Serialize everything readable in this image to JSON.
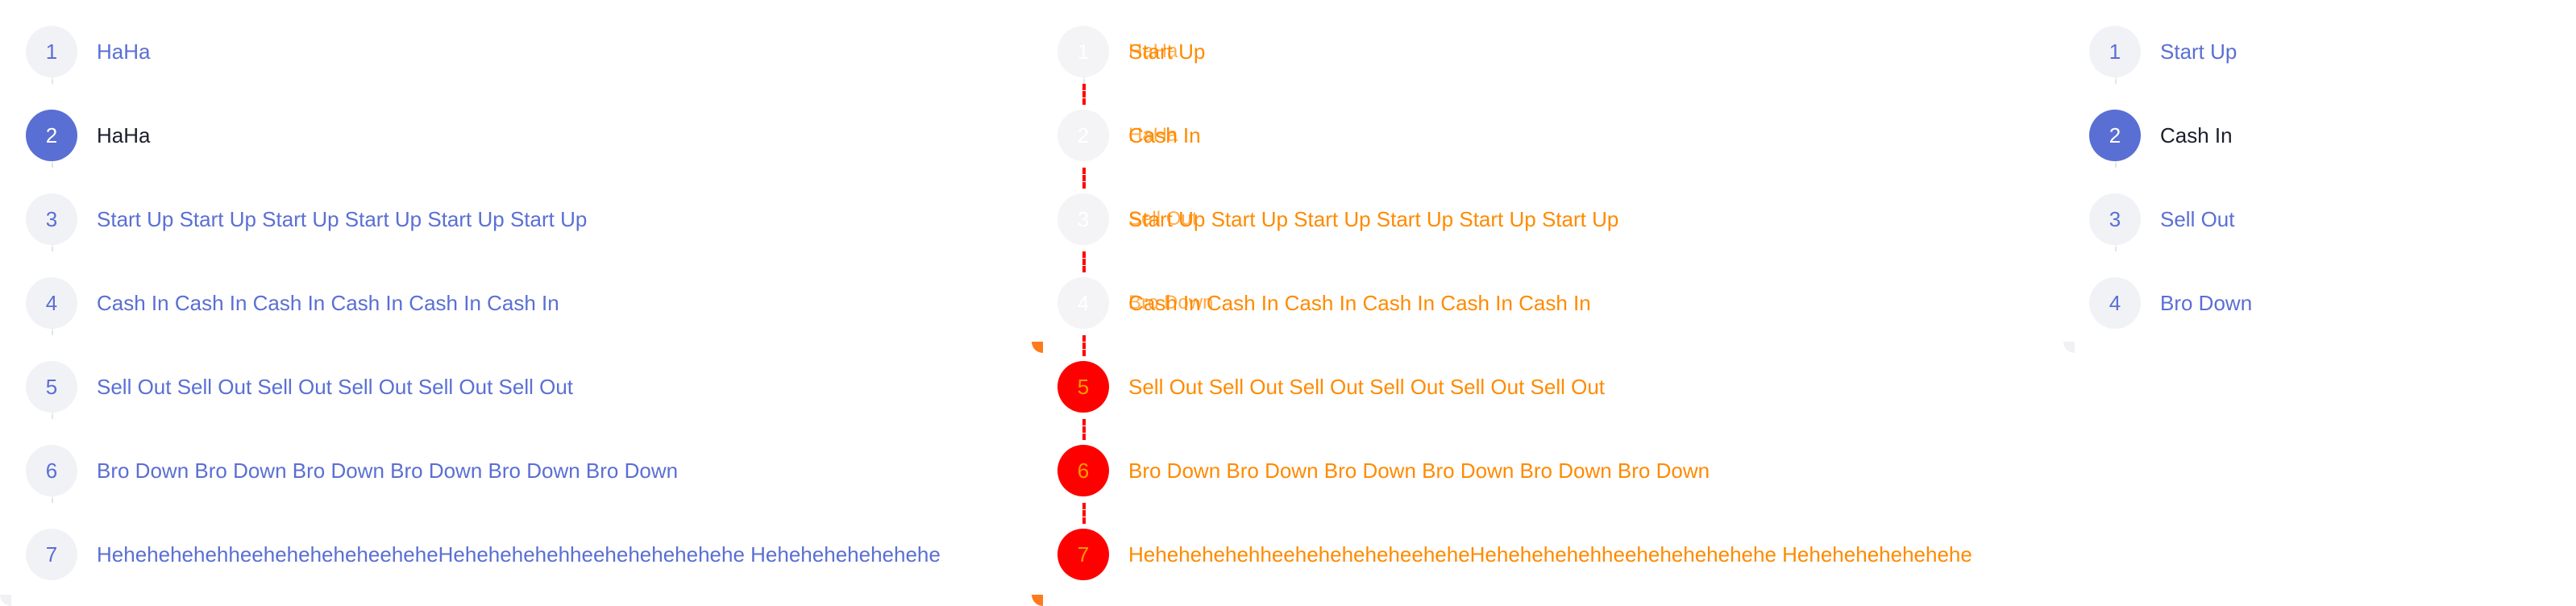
{
  "panel1": {
    "steps": [
      {
        "number": "1",
        "label": "HaHa"
      },
      {
        "number": "2",
        "label": "HaHa"
      },
      {
        "number": "3",
        "label": "Start Up Start Up Start Up Start Up Start Up Start Up"
      },
      {
        "number": "4",
        "label": "Cash In Cash In Cash In Cash In Cash In Cash In"
      },
      {
        "number": "5",
        "label": "Sell Out Sell Out Sell Out Sell Out Sell Out Sell Out"
      },
      {
        "number": "6",
        "label": "Bro Down Bro Down Bro Down Bro Down Bro Down Bro Down"
      },
      {
        "number": "7",
        "label": "HehehehehehheeheheheheheeheheHehehehehehheehehehehehehe Hehehehehehehehe"
      }
    ]
  },
  "panel2": {
    "steps": [
      {
        "number": "1",
        "label": "Start Up",
        "ghost": "HaHa"
      },
      {
        "number": "2",
        "label": "Cash In",
        "ghost": "HaHa"
      },
      {
        "number": "3",
        "label": "Start Up Start Up Start Up Start Up Start Up Start Up",
        "ghost": "Sell Out"
      },
      {
        "number": "4",
        "label": "Cash In Cash In Cash In Cash In Cash In Cash In",
        "ghost": "Bro Down"
      },
      {
        "number": "5",
        "label": "Sell Out Sell Out Sell Out Sell Out Sell Out Sell Out"
      },
      {
        "number": "6",
        "label": "Bro Down Bro Down Bro Down Bro Down Bro Down Bro Down"
      },
      {
        "number": "7",
        "label": "HehehehehehheeheheheheheeheheHehehehehehheehehehehehehe Hehehehehehehehe"
      }
    ]
  },
  "panel3": {
    "steps": [
      {
        "number": "1",
        "label": "Start Up"
      },
      {
        "number": "2",
        "label": "Cash In"
      },
      {
        "number": "3",
        "label": "Sell Out"
      },
      {
        "number": "4",
        "label": "Bro Down"
      }
    ]
  },
  "colors": {
    "primary": "#5a6fd3",
    "active_text": "#1b1e2b",
    "inactive_bg": "#f1f2f6",
    "error_red": "#ff0000",
    "warning_orange": "#ff8a00"
  }
}
